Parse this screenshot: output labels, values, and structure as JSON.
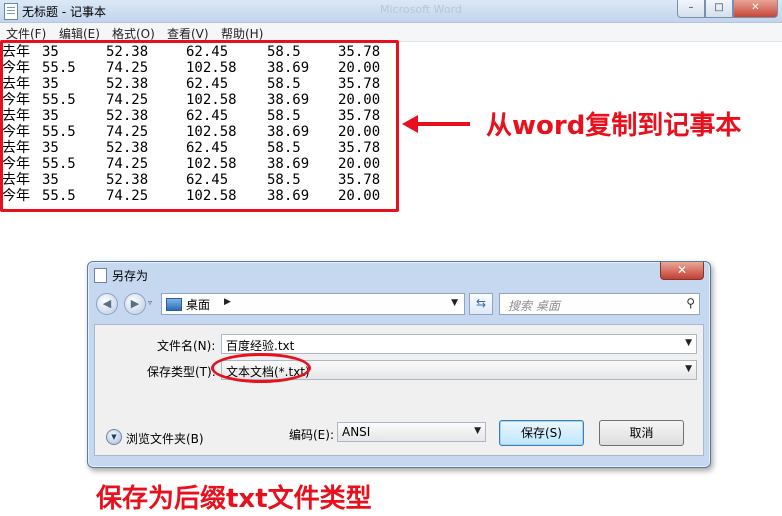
{
  "notepad": {
    "title": "无标题 - 记事本",
    "ghost_title": "Microsoft Word",
    "window_controls": {
      "minimize": "–",
      "maximize": "□",
      "close": "✕"
    },
    "menu": [
      {
        "label": "文件(F)"
      },
      {
        "label": "编辑(E)"
      },
      {
        "label": "格式(O)"
      },
      {
        "label": "查看(V)"
      },
      {
        "label": "帮助(H)"
      }
    ],
    "rows": [
      [
        "去年",
        "35",
        "52.38",
        "62.45",
        "58.5",
        "35.78"
      ],
      [
        "今年",
        "55.5",
        "74.25",
        "102.58",
        "38.69",
        "20.00"
      ],
      [
        "去年",
        "35",
        "52.38",
        "62.45",
        "58.5",
        "35.78"
      ],
      [
        "今年",
        "55.5",
        "74.25",
        "102.58",
        "38.69",
        "20.00"
      ],
      [
        "去年",
        "35",
        "52.38",
        "62.45",
        "58.5",
        "35.78"
      ],
      [
        "今年",
        "55.5",
        "74.25",
        "102.58",
        "38.69",
        "20.00"
      ],
      [
        "去年",
        "35",
        "52.38",
        "62.45",
        "58.5",
        "35.78"
      ],
      [
        "今年",
        "55.5",
        "74.25",
        "102.58",
        "38.69",
        "20.00"
      ],
      [
        "去年",
        "35",
        "52.38",
        "62.45",
        "58.5",
        "35.78"
      ],
      [
        "今年",
        "55.5",
        "74.25",
        "102.58",
        "38.69",
        "20.00"
      ]
    ]
  },
  "annotations": {
    "copy_note": "从word复制到记事本",
    "save_note": "保存为后缀txt文件类型",
    "color": "#e8101c"
  },
  "dialog": {
    "title": "另存为",
    "close_label": "✕",
    "back_label": "◀",
    "forward_label": "▶",
    "nav_dropdown": "▿",
    "address": "桌面",
    "address_chevron": "▶",
    "address_dropdown": "▼",
    "refresh_label": "⇆",
    "search_placeholder": "搜索 桌面",
    "search_icon_glyph": "⚲",
    "filename_label": "文件名(N):",
    "filename_value": "百度经验.txt",
    "filetype_label": "保存类型(T):",
    "filetype_value": "文本文档(*.txt)",
    "browse_glyph": "▼",
    "browse_label": "浏览文件夹(B)",
    "encoding_label": "编码(E):",
    "encoding_value": "ANSI",
    "save_button": "保存(S)",
    "cancel_button": "取消",
    "dropdown_glyph": "▼"
  }
}
